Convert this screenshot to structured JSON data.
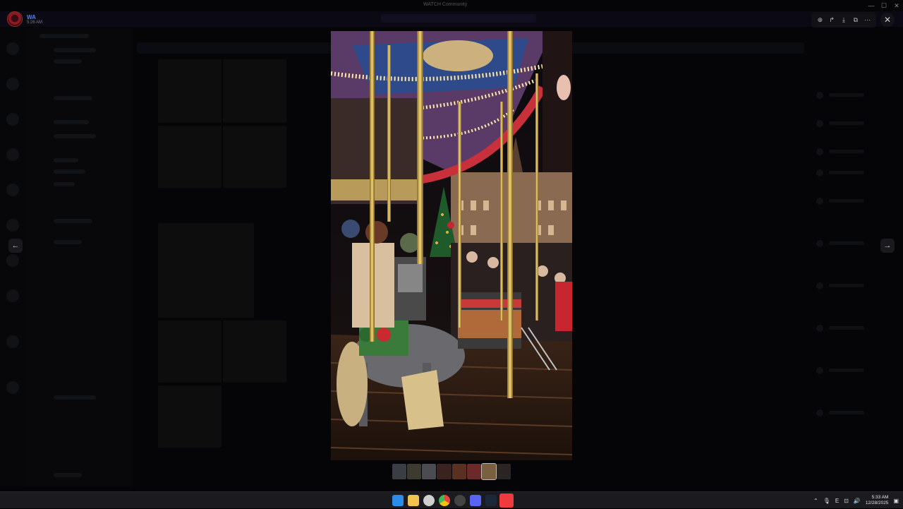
{
  "window": {
    "title": "WATCH Community"
  },
  "user": {
    "name": "WA",
    "time": "5:26 AM"
  },
  "viewer": {
    "toolbar": [
      {
        "icon": "zoom-in-icon",
        "glyph": "⊕"
      },
      {
        "icon": "forward-icon",
        "glyph": "↱"
      },
      {
        "icon": "download-icon",
        "glyph": "⤓"
      },
      {
        "icon": "open-external-icon",
        "glyph": "⧉"
      },
      {
        "icon": "more-icon",
        "glyph": "⋯"
      }
    ],
    "close_glyph": "✕",
    "prev_glyph": "←",
    "next_glyph": "→",
    "image_alt": "Carousel at night in front of GUM, Red Square, with a decorated Christmas tree",
    "thumbnails_count": 8
  },
  "taskbar": {
    "apps": [
      {
        "name": "start-icon",
        "color": "#2b8de8"
      },
      {
        "name": "file-explorer-icon",
        "color": "#f2c14e"
      },
      {
        "name": "settings-icon",
        "color": "#cfcfcf"
      },
      {
        "name": "chrome-icon",
        "color": "#e8453c"
      },
      {
        "name": "obs-icon",
        "color": "#444444"
      },
      {
        "name": "discord-icon",
        "color": "#5865f2"
      },
      {
        "name": "steam-icon",
        "color": "#1b2838"
      },
      {
        "name": "anydesk-icon",
        "color": "#ef3b3b"
      }
    ],
    "tray_lang": "E",
    "clock_time": "5:33 AM",
    "clock_date": "12/28/2025"
  }
}
